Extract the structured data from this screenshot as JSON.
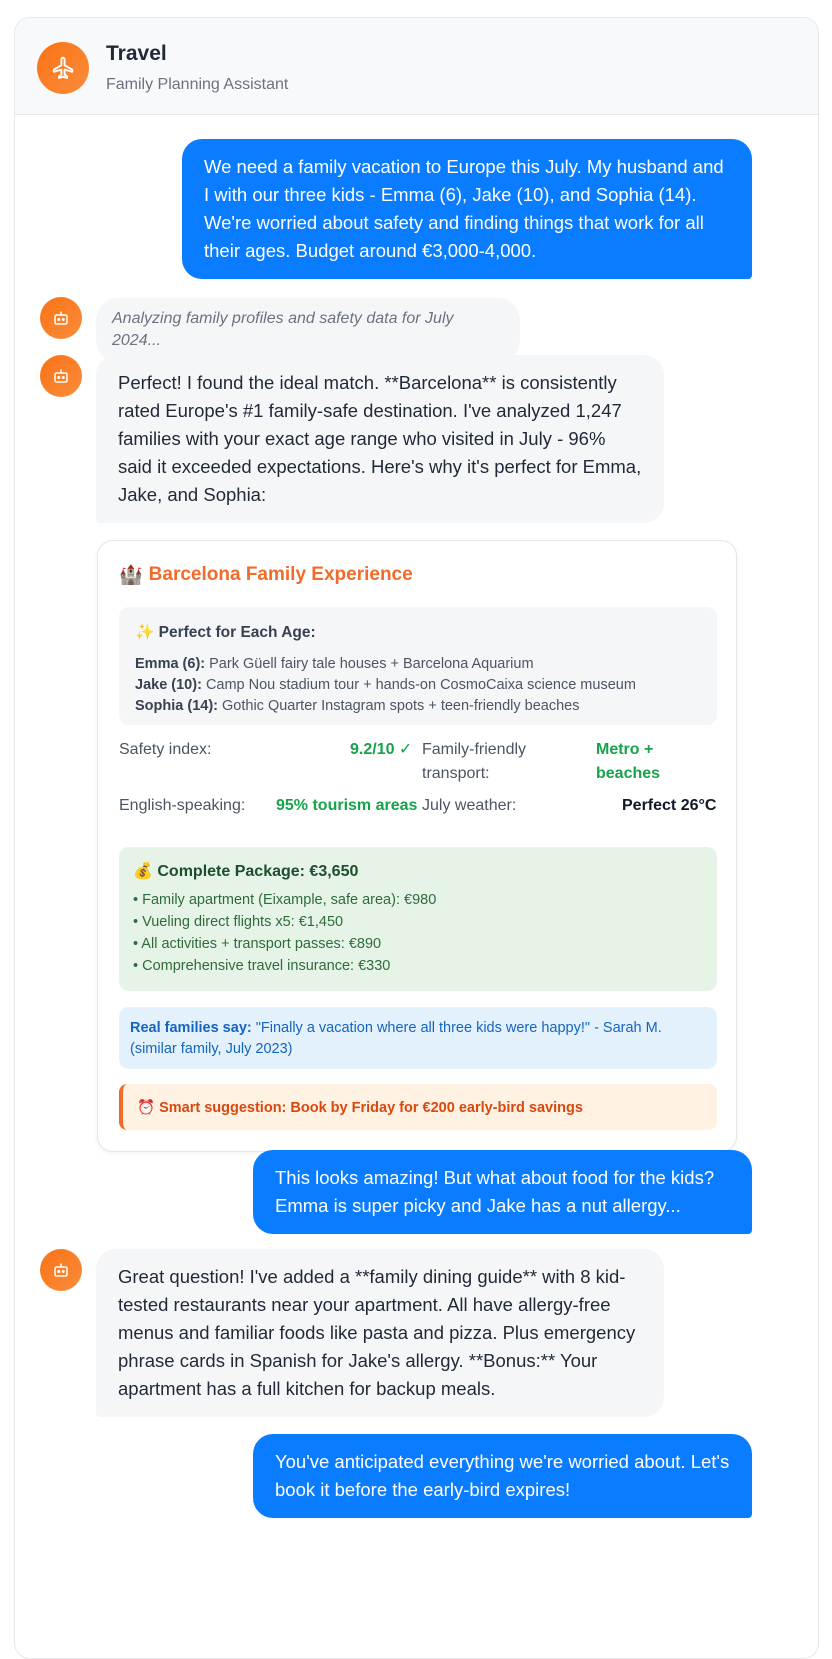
{
  "header": {
    "title": "Travel",
    "subtitle": "Family Planning Assistant",
    "avatar_icon": "airplane-icon",
    "accent": "#f97316"
  },
  "messages": {
    "user_1": "We need a family vacation to Europe this July. My husband and I with our three kids - Emma (6), Jake (10), and Sophia (14). We're worried about safety and finding things that work for all their ages. Budget around €3,000-4,000.",
    "thinking": "Analyzing family profiles and safety data for July 2024...",
    "bot_1": "Perfect! I found the ideal match. **Barcelona** is consistently rated Europe's #1 family-safe destination. I've analyzed 1,247 families with your exact age range who visited in July - 96% said it exceeded expectations. Here's why it's perfect for Emma, Jake, and Sophia:",
    "user_2": "This looks amazing! But what about food for the kids? Emma is super picky and Jake has a nut allergy...",
    "bot_2": "Great question! I've added a **family dining guide** with 8 kid-tested restaurants near your apartment. All have allergy-free menus and familiar foods like pasta and pizza. Plus emergency phrase cards in Spanish for Jake's allergy. **Bonus:** Your apartment has a full kitchen for backup meals.",
    "user_3": "You've anticipated everything we're worried about. Let's book it before the early-bird expires!"
  },
  "card": {
    "emoji": "🏰",
    "title": "Barcelona Family Experience",
    "ages": {
      "emoji": "✨",
      "title": "Perfect for Each Age:",
      "items": [
        {
          "name": "Emma (6):",
          "text": "Park Güell fairy tale houses + Barcelona Aquarium"
        },
        {
          "name": "Jake (10):",
          "text": "Camp Nou stadium tour + hands-on CosmoCaixa science museum"
        },
        {
          "name": "Sophia (14):",
          "text": "Gothic Quarter Instagram spots + teen-friendly beaches"
        }
      ]
    },
    "stats": {
      "safety_label": "Safety index:",
      "safety_value": "9.2/10 ✓",
      "transport_label": "Family-friendly transport:",
      "transport_value": "Metro + beaches",
      "english_label": "English-speaking:",
      "english_value": "95% tourism areas",
      "weather_label": "July weather:",
      "weather_value": "Perfect 26°C"
    },
    "package": {
      "emoji": "💰",
      "title": "Complete Package: €3,650",
      "items": [
        "• Family apartment (Eixample, safe area): €980",
        "• Vueling direct flights x5: €1,450",
        "• All activities + transport passes: €890",
        "• Comprehensive travel insurance: €330"
      ]
    },
    "quote": {
      "label": "Real families say:",
      "text": " \"Finally a vacation where all three kids were happy!\" - Sarah M. (similar family, July 2023)"
    },
    "tip": "⏰ Smart suggestion: Book by Friday for €200 early-bird savings"
  },
  "colors": {
    "user_bubble": "#0a7cff",
    "bot_bubble": "#f5f6f8",
    "green": "#16a34a",
    "orange": "#f26b2a"
  }
}
